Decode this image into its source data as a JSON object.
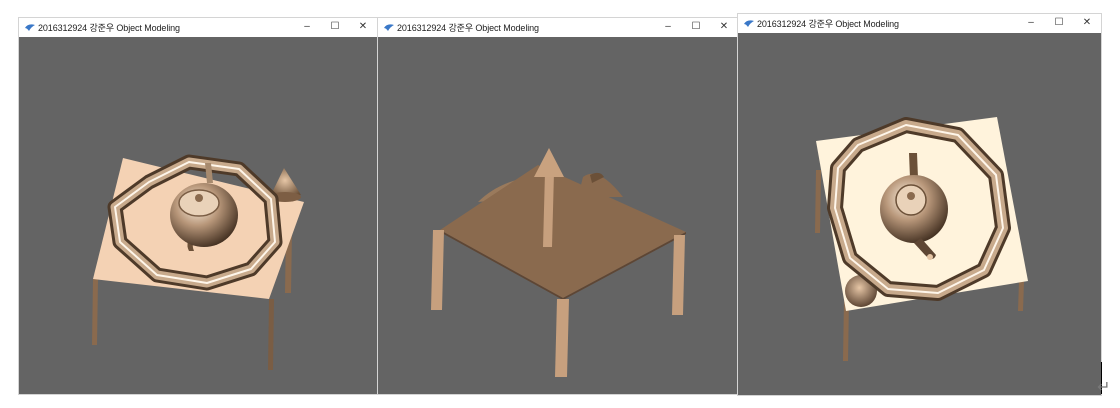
{
  "windows": [
    {
      "title": "2016312924 강준우 Object Modeling",
      "min": "–",
      "max": "☐",
      "close": "✕",
      "view": "top-tilted"
    },
    {
      "title": "2016312924 강준우 Object Modeling",
      "min": "–",
      "max": "☐",
      "close": "✕",
      "view": "from-below"
    },
    {
      "title": "2016312924 강준우 Object Modeling",
      "min": "–",
      "max": "☐",
      "close": "✕",
      "view": "top-down"
    }
  ],
  "doc_mark": "↵",
  "colors": {
    "viewport_bg": "#646464",
    "table_top": "#f4d2b4",
    "table_top_light": "#fff3dc",
    "table_underside": "#8a6a4e",
    "leg": "#c7a07e",
    "metal": "#b49478"
  },
  "icons": [
    "app-icon",
    "minimize-icon",
    "maximize-icon",
    "close-icon"
  ]
}
